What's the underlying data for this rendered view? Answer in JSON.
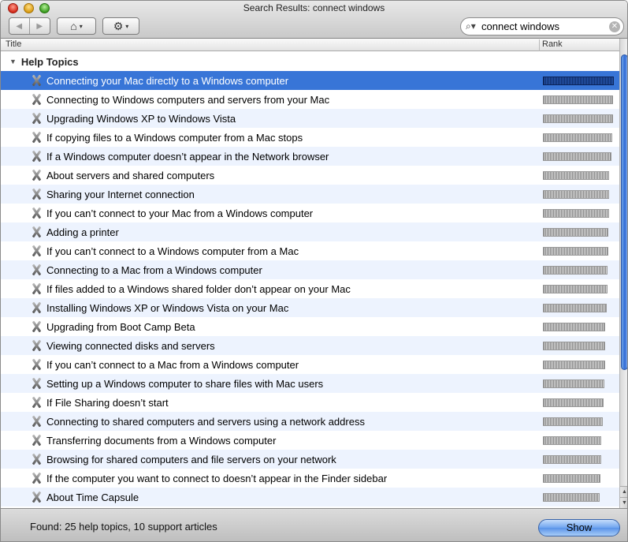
{
  "window": {
    "title": "Search Results: connect windows"
  },
  "toolbar": {
    "back_glyph": "◀",
    "forward_glyph": "▶",
    "home_glyph": "⌂",
    "gear_glyph": "⚙",
    "caret_glyph": "▾"
  },
  "search": {
    "value": "connect windows",
    "clear_glyph": "✕",
    "mag_glyph": "⌕▾"
  },
  "columns": {
    "title": "Title",
    "rank": "Rank"
  },
  "group": {
    "label": "Help Topics",
    "disclosure": "▼"
  },
  "results": [
    {
      "title": "Connecting your Mac directly to a Windows computer",
      "rank": 1.0,
      "selected": true
    },
    {
      "title": "Connecting to Windows computers and servers from your Mac",
      "rank": 0.99
    },
    {
      "title": "Upgrading Windows XP to Windows Vista",
      "rank": 0.99
    },
    {
      "title": "If copying files to a Windows computer from a Mac stops",
      "rank": 0.98
    },
    {
      "title": "If a Windows computer doesn’t appear in the Network browser",
      "rank": 0.97
    },
    {
      "title": "About servers and shared computers",
      "rank": 0.93
    },
    {
      "title": "Sharing your Internet connection",
      "rank": 0.93
    },
    {
      "title": "If you can’t connect to your Mac from a Windows computer",
      "rank": 0.93
    },
    {
      "title": "Adding a printer",
      "rank": 0.92
    },
    {
      "title": "If you can’t connect to a Windows computer from a Mac",
      "rank": 0.92
    },
    {
      "title": "Connecting to a Mac from a Windows computer",
      "rank": 0.91
    },
    {
      "title": "If files added to a Windows shared folder don’t appear on your Mac",
      "rank": 0.91
    },
    {
      "title": "Installing Windows XP or Windows Vista on your Mac",
      "rank": 0.9
    },
    {
      "title": "Upgrading from Boot Camp Beta",
      "rank": 0.88
    },
    {
      "title": "Viewing connected disks and servers",
      "rank": 0.88
    },
    {
      "title": "If you can’t connect to a Mac from a Windows computer",
      "rank": 0.88
    },
    {
      "title": "Setting up a Windows computer to share files with Mac users",
      "rank": 0.87
    },
    {
      "title": "If File Sharing doesn’t start",
      "rank": 0.86
    },
    {
      "title": "Connecting to shared computers and servers using a network address",
      "rank": 0.84
    },
    {
      "title": "Transferring documents from a Windows computer",
      "rank": 0.82
    },
    {
      "title": "Browsing for shared computers and file servers on your network",
      "rank": 0.82
    },
    {
      "title": "If the computer you want to connect to doesn’t appear in the Finder sidebar",
      "rank": 0.81
    },
    {
      "title": "About Time Capsule",
      "rank": 0.8
    }
  ],
  "footer": {
    "status": "Found: 25 help topics, 10 support articles",
    "show_label": "Show"
  },
  "scrollbar": {
    "up_glyph": "▲",
    "down_glyph": "▼"
  }
}
